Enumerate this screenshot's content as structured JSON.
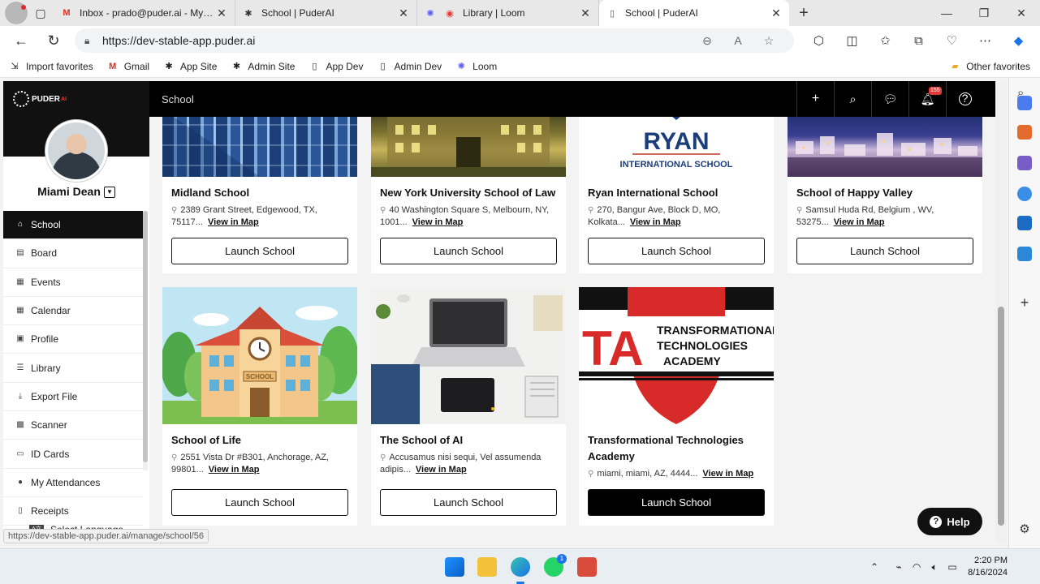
{
  "browser": {
    "tabs": [
      {
        "title": "Inbox - prado@puder.ai - My Life",
        "favicon": "gmail-icon",
        "close": "✕"
      },
      {
        "title": "School | PuderAI",
        "favicon": "puderai-icon",
        "close": "✕"
      },
      {
        "title": "Library | Loom",
        "favicon": "loom-icon",
        "close": "✕"
      },
      {
        "title": "School | PuderAI",
        "favicon": "page-icon",
        "close": "✕"
      }
    ],
    "new_tab": "+",
    "url": "https://dev-stable-app.puder.ai",
    "bookmarks": [
      {
        "label": "Import favorites"
      },
      {
        "label": "Gmail"
      },
      {
        "label": "App Site"
      },
      {
        "label": "Admin Site"
      },
      {
        "label": "App Dev"
      },
      {
        "label": "Admin Dev"
      },
      {
        "label": "Loom"
      }
    ],
    "other_favorites": "Other favorites",
    "status_url": "https://dev-stable-app.puder.ai/manage/school/56"
  },
  "app": {
    "logo_text": "PUDER",
    "logo_ai": "AI",
    "user_name": "Miami Dean",
    "header_title": "School",
    "notification_count": "155",
    "menu": [
      {
        "label": "School",
        "icon": "school-icon",
        "active": true
      },
      {
        "label": "Board",
        "icon": "board-icon"
      },
      {
        "label": "Events",
        "icon": "events-icon"
      },
      {
        "label": "Calendar",
        "icon": "calendar-icon"
      },
      {
        "label": "Profile",
        "icon": "profile-icon"
      },
      {
        "label": "Library",
        "icon": "library-icon"
      },
      {
        "label": "Export File",
        "icon": "export-icon"
      },
      {
        "label": "Scanner",
        "icon": "scanner-icon"
      },
      {
        "label": "ID Cards",
        "icon": "id-card-icon"
      },
      {
        "label": "My Attendances",
        "icon": "attendance-icon"
      },
      {
        "label": "Receipts",
        "icon": "receipt-icon"
      }
    ],
    "select_language": "Select Language",
    "help_label": "Help",
    "view_in_map": "View in Map",
    "launch_label": "Launch School",
    "schools": [
      {
        "name": "Midland School",
        "address": "2389 Grant Street, Edgewood, TX, 75117..."
      },
      {
        "name": "New York University School of Law",
        "address": "40 Washington Square S, Melbourn, NY, 1001..."
      },
      {
        "name": "Ryan International School",
        "address": "270, Bangur Ave, Block D, MO, Kolkata..."
      },
      {
        "name": "School of Happy Valley",
        "address": "Samsul Huda Rd, Belgium , WV, 53275..."
      },
      {
        "name": "School of Life",
        "address": "2551 Vista Dr #B301, Anchorage, AZ, 99801..."
      },
      {
        "name": "The School of AI",
        "address": "Accusamus nisi sequi, Vel assumenda adipis..."
      },
      {
        "name": "Transformational Technologies Academy",
        "address": "miami, miami, AZ, 4444..."
      }
    ],
    "ryan_logo_top": "RYAN",
    "ryan_logo_bottom": "INTERNATIONAL SCHOOL",
    "school_sign": "SCHOOL",
    "tta_lines": [
      "TRANSFORMATIONAL",
      "TECHNOLOGIES",
      "ACADEMY"
    ],
    "tta_mark": "TA"
  },
  "taskbar": {
    "time": "2:20 PM",
    "date": "8/16/2024",
    "whatsapp_badge": "1"
  }
}
